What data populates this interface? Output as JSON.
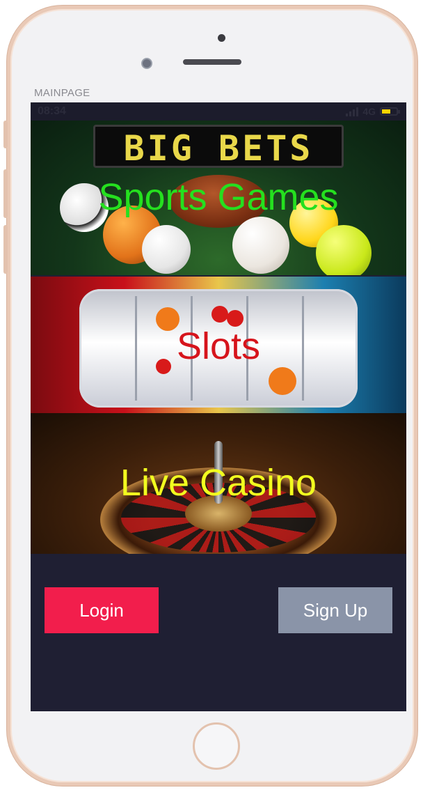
{
  "page": {
    "label": "MAINPAGE"
  },
  "status_bar": {
    "time": "08:34",
    "network": "4G",
    "battery_level": 0.6
  },
  "banners": [
    {
      "title": "Sports Games",
      "title_color": "#25e01f",
      "board_text": "BIG BETS"
    },
    {
      "title": "Slots",
      "title_color": "#d6141c"
    },
    {
      "title": "Live Casino",
      "title_color": "#f2ff1f"
    }
  ],
  "actions": {
    "login_label": "Login",
    "signup_label": "Sign Up",
    "login_color": "#f21e4c",
    "signup_color": "#8a94a8"
  },
  "icons": {
    "signal": "signal-bars-icon",
    "battery": "battery-icon",
    "home": "home-button-icon"
  }
}
